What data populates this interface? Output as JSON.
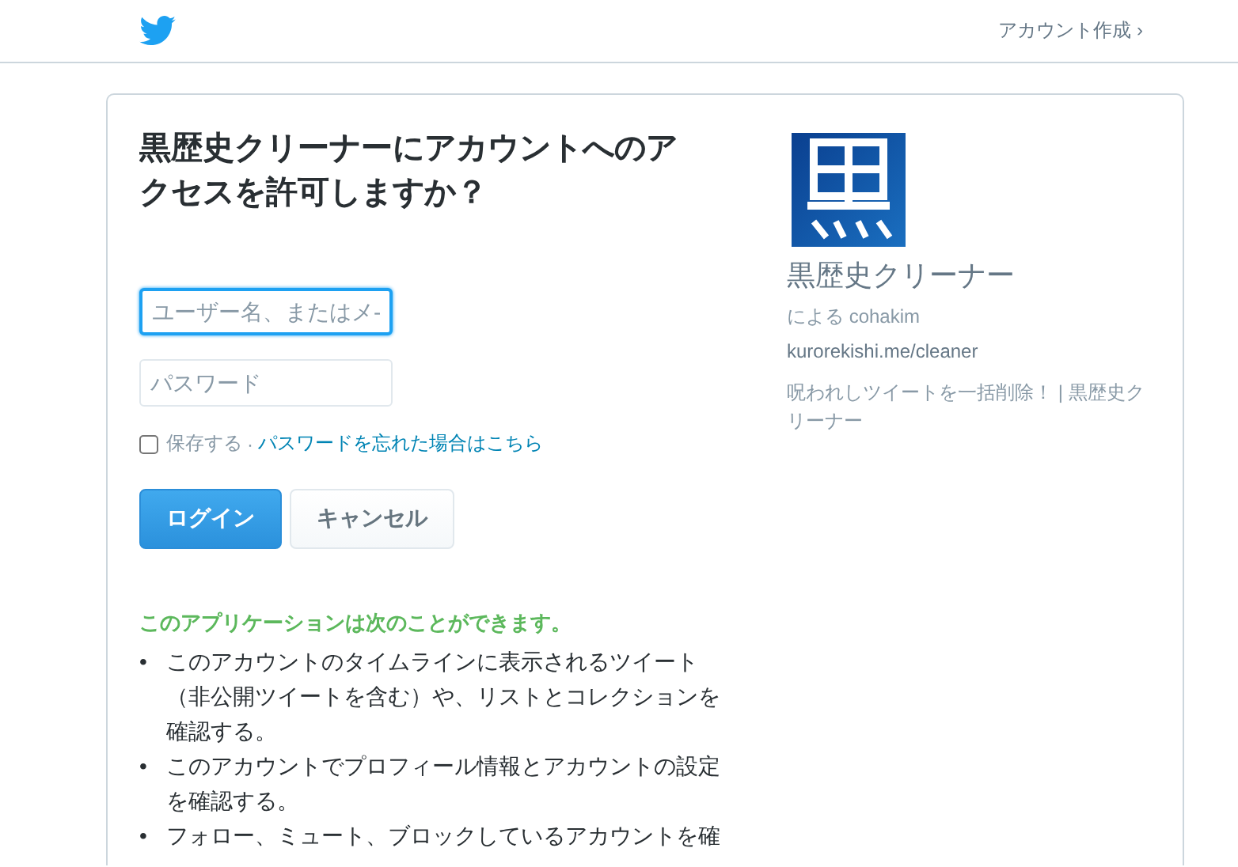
{
  "header": {
    "signup_link": "アカウント作成 ›"
  },
  "form": {
    "title": "黒歴史クリーナーにアカウントへのアクセスを許可しますか？",
    "username": {
      "placeholder": "ユーザー名、またはメ-",
      "focused": true
    },
    "password": {
      "placeholder": "パスワード"
    },
    "remember": {
      "label": "保存する",
      "checked": false
    },
    "separator": "·",
    "forgot_link": "パスワードを忘れた場合はこちら",
    "buttons": [
      {
        "label": "ログイン",
        "kind": "primary"
      },
      {
        "label": "キャンセル",
        "kind": "secondary"
      }
    ]
  },
  "permissions": {
    "heading": "このアプリケーションは次のことができます。",
    "items": [
      {
        "bullet": "•",
        "text": "このアカウントのタイムラインに表示されるツイート（非公開ツイートを含む）や、リストとコレクションを確認する。"
      },
      {
        "bullet": "•",
        "text": "このアカウントでプロフィール情報とアカウントの設定を確認する。"
      },
      {
        "bullet": "•",
        "text": "フォロー、ミュート、ブロックしているアカウントを確"
      }
    ]
  },
  "app": {
    "name": "黒歴史クリーナー",
    "author": "による cohakim",
    "url": "kurorekishi.me/cleaner",
    "description": "呪われしツイートを一括削除！ | 黒歴史クリーナー"
  }
}
